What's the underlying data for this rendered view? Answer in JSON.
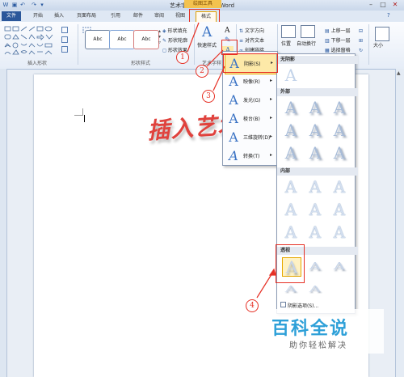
{
  "window": {
    "title": "艺术字 - Microsoft Word",
    "context_tab_group": "绘图工具"
  },
  "tabs": [
    "文件",
    "开始",
    "插入",
    "页面布局",
    "引用",
    "邮件",
    "审阅",
    "视图",
    "格式"
  ],
  "ribbon": {
    "insert_shapes_label": "插入形状",
    "shape_styles_label": "形状样式",
    "shape_style_sample": "Abc",
    "shape_fill": "形状填充",
    "shape_outline": "形状轮廓",
    "shape_effects": "形状效果",
    "quick_styles": "快速样式",
    "art_styles_label": "艺术字样式",
    "text_direction": "文字方向",
    "align_text": "对齐文本",
    "create_link": "创建链接",
    "position": "位置",
    "wrap_text": "自动换行",
    "bring_forward": "上移一层",
    "send_backward": "下移一层",
    "selection_pane": "选择窗格",
    "size": "大小"
  },
  "document": {
    "wordart_text": "插入艺术"
  },
  "effects_menu": [
    {
      "label": "阴影(S)",
      "active": true
    },
    {
      "label": "映像(R)"
    },
    {
      "label": "发光(G)"
    },
    {
      "label": "棱台(B)"
    },
    {
      "label": "三维旋转(D)"
    },
    {
      "label": "转换(T)"
    }
  ],
  "shadow_gallery": {
    "no_shadow": "无阴影",
    "outer": "外部",
    "inner": "内部",
    "perspective": "透视",
    "options": "阴影选项(S)...",
    "glyph": "A"
  },
  "annotations": [
    "1",
    "2",
    "3",
    "4"
  ],
  "watermark": {
    "title": "百科全说",
    "subtitle": "助你轻松解决"
  },
  "colors": {
    "accent_red": "#e63025",
    "file_tab": "#2b579a",
    "wordart": "#e0423d",
    "watermark_blue": "#2ea0d8"
  }
}
